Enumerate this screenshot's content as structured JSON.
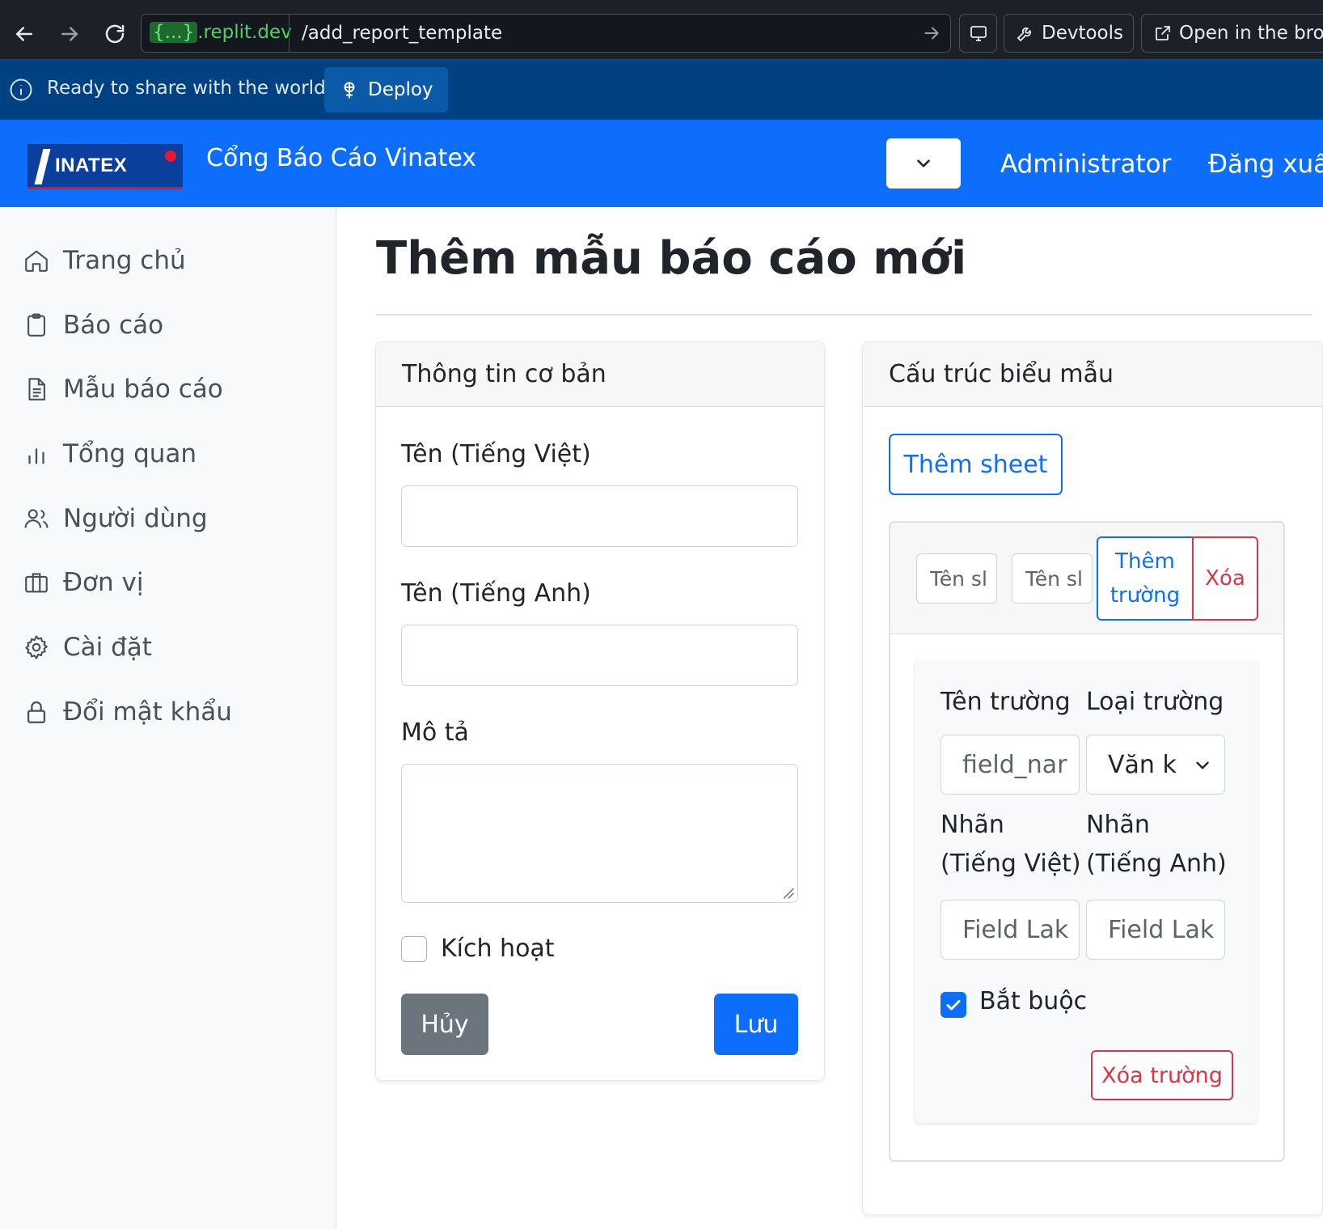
{
  "browser": {
    "url_host": "{...}.replit.dev",
    "url_host_brace": "{...}",
    "url_host_rest": ".replit.dev",
    "url_path": "/add_report_template",
    "devtools_label": "Devtools",
    "open_label": "Open in the brow"
  },
  "banner": {
    "text": "Ready to share with the world?",
    "deploy_label": "Deploy"
  },
  "header": {
    "logo_text": "INATEX",
    "brand": "Cổng Báo Cáo Vinatex",
    "user": "Administrator",
    "logout": "Đăng xuất"
  },
  "sidebar": {
    "items": [
      {
        "label": "Trang chủ",
        "icon": "house-icon"
      },
      {
        "label": "Báo cáo",
        "icon": "clipboard-icon"
      },
      {
        "label": "Mẫu báo cáo",
        "icon": "file-text-icon"
      },
      {
        "label": "Tổng quan",
        "icon": "bar-chart-icon"
      },
      {
        "label": "Người dùng",
        "icon": "users-icon"
      },
      {
        "label": "Đơn vị",
        "icon": "briefcase-icon"
      },
      {
        "label": "Cài đặt",
        "icon": "gear-icon"
      },
      {
        "label": "Đổi mật khẩu",
        "icon": "lock-icon"
      }
    ]
  },
  "page": {
    "title": "Thêm mẫu báo cáo mới"
  },
  "basic_info": {
    "header": "Thông tin cơ bản",
    "name_vi_label": "Tên (Tiếng Việt)",
    "name_en_label": "Tên (Tiếng Anh)",
    "description_label": "Mô tả",
    "active_label": "Kích hoạt",
    "active_checked": false,
    "cancel_label": "Hủy",
    "save_label": "Lưu"
  },
  "structure": {
    "header": "Cấu trúc biểu mẫu",
    "add_sheet_label": "Thêm sheet",
    "sheet": {
      "name_vi_placeholder": "Tên sl",
      "name_en_placeholder": "Tên sl",
      "add_field_label": "Thêm trường",
      "delete_label": "Xóa",
      "field": {
        "name_label": "Tên trường",
        "type_label": "Loại trường",
        "name_placeholder": "field_nar",
        "type_value": "Văn k",
        "label_vi_label": "Nhãn (Tiếng Việt)",
        "label_en_label": "Nhãn (Tiếng Anh)",
        "label_vi_placeholder": "Field Lak",
        "label_en_placeholder": "Field Lak",
        "required_label": "Bắt buộc",
        "required_checked": true,
        "delete_field_label": "Xóa trường"
      }
    }
  },
  "colors": {
    "primary": "#0d6efd",
    "danger": "#dc3545",
    "secondary": "#6c757d",
    "banner": "#004182",
    "chrome": "#1c2029"
  }
}
